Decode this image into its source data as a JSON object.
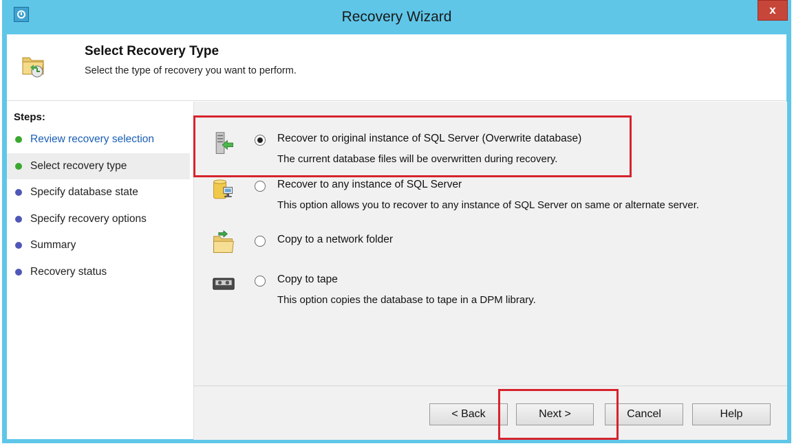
{
  "window": {
    "title": "Recovery Wizard",
    "close_label": "x"
  },
  "header": {
    "title": "Select Recovery Type",
    "subtitle": "Select the type of recovery you want to perform."
  },
  "steps": {
    "heading": "Steps:",
    "items": [
      {
        "label": "Review recovery selection",
        "state": "done"
      },
      {
        "label": "Select recovery type",
        "state": "current"
      },
      {
        "label": "Specify database state",
        "state": "pending"
      },
      {
        "label": "Specify recovery options",
        "state": "pending"
      },
      {
        "label": "Summary",
        "state": "pending"
      },
      {
        "label": "Recovery status",
        "state": "pending"
      }
    ]
  },
  "options": [
    {
      "label": "Recover to original instance of SQL Server (Overwrite database)",
      "description": "The current database files will be overwritten during recovery.",
      "selected": true,
      "icon": "server-restore-icon"
    },
    {
      "label": "Recover to any instance of SQL Server",
      "description": "This option allows you to recover to any instance of SQL Server on same or alternate server.",
      "selected": false,
      "icon": "database-server-icon"
    },
    {
      "label": "Copy to a network folder",
      "description": "",
      "selected": false,
      "icon": "network-folder-icon"
    },
    {
      "label": "Copy to tape",
      "description": "This option copies the database to tape in a DPM library.",
      "selected": false,
      "icon": "tape-icon"
    }
  ],
  "buttons": {
    "back": "< Back",
    "next": "Next >",
    "cancel": "Cancel",
    "help": "Help"
  },
  "colors": {
    "titlebar": "#5fc6e8",
    "step_done_dot": "#3aa82f",
    "step_pending_dot": "#4f57b8",
    "highlight": "#d6232c",
    "active_step_text": "#1a5fb4"
  }
}
